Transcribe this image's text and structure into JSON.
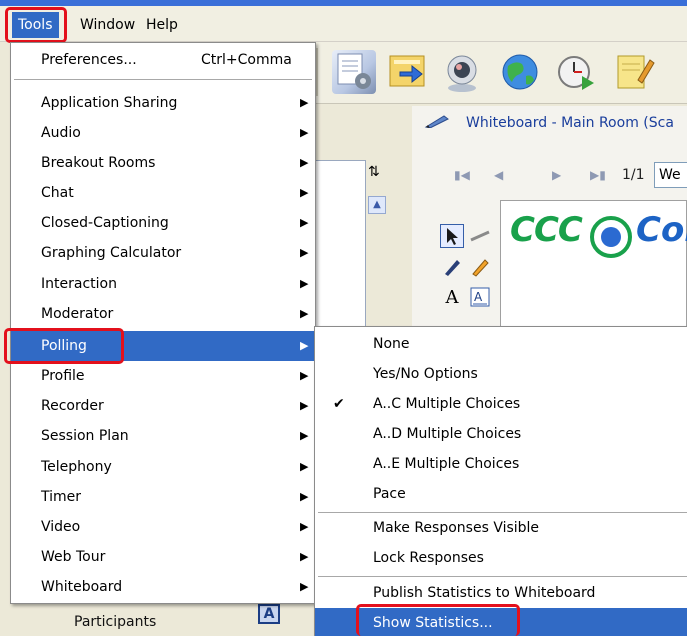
{
  "menubar": {
    "items": [
      {
        "label": "Tools"
      },
      {
        "label": "Window"
      },
      {
        "label": "Help"
      }
    ]
  },
  "tools_menu": {
    "items": [
      {
        "label": "Preferences...",
        "shortcut": "Ctrl+Comma",
        "submenu": false
      },
      {
        "label": "Application Sharing",
        "submenu": true
      },
      {
        "label": "Audio",
        "submenu": true
      },
      {
        "label": "Breakout Rooms",
        "submenu": true
      },
      {
        "label": "Chat",
        "submenu": true
      },
      {
        "label": "Closed-Captioning",
        "submenu": true
      },
      {
        "label": "Graphing Calculator",
        "submenu": true
      },
      {
        "label": "Interaction",
        "submenu": true
      },
      {
        "label": "Moderator",
        "submenu": true
      },
      {
        "label": "Polling",
        "submenu": true
      },
      {
        "label": "Profile",
        "submenu": true
      },
      {
        "label": "Recorder",
        "submenu": true
      },
      {
        "label": "Session Plan",
        "submenu": true
      },
      {
        "label": "Telephony",
        "submenu": true
      },
      {
        "label": "Timer",
        "submenu": true
      },
      {
        "label": "Video",
        "submenu": true
      },
      {
        "label": "Web Tour",
        "submenu": true
      },
      {
        "label": "Whiteboard",
        "submenu": true
      }
    ]
  },
  "polling_menu": {
    "items": [
      {
        "label": "None"
      },
      {
        "label": "Yes/No Options"
      },
      {
        "label": "A..C Multiple Choices",
        "checked": true
      },
      {
        "label": "A..D Multiple Choices"
      },
      {
        "label": "A..E Multiple Choices"
      },
      {
        "label": "Pace"
      },
      {
        "label": "Make Responses Visible"
      },
      {
        "label": "Lock Responses"
      },
      {
        "label": "Publish Statistics to Whiteboard"
      },
      {
        "label": "Show Statistics..."
      }
    ]
  },
  "whiteboard": {
    "title": "Whiteboard - Main Room (Sca",
    "page_indicator": "1/1",
    "page_field": "We",
    "logo_left": "CCC",
    "logo_right": "Con"
  },
  "participants_label": "Participants",
  "colors": {
    "menu_highlight": "#316ac5",
    "callout_red": "#e3101c",
    "logo_green": "#19a14b",
    "logo_blue": "#1d63c5"
  }
}
